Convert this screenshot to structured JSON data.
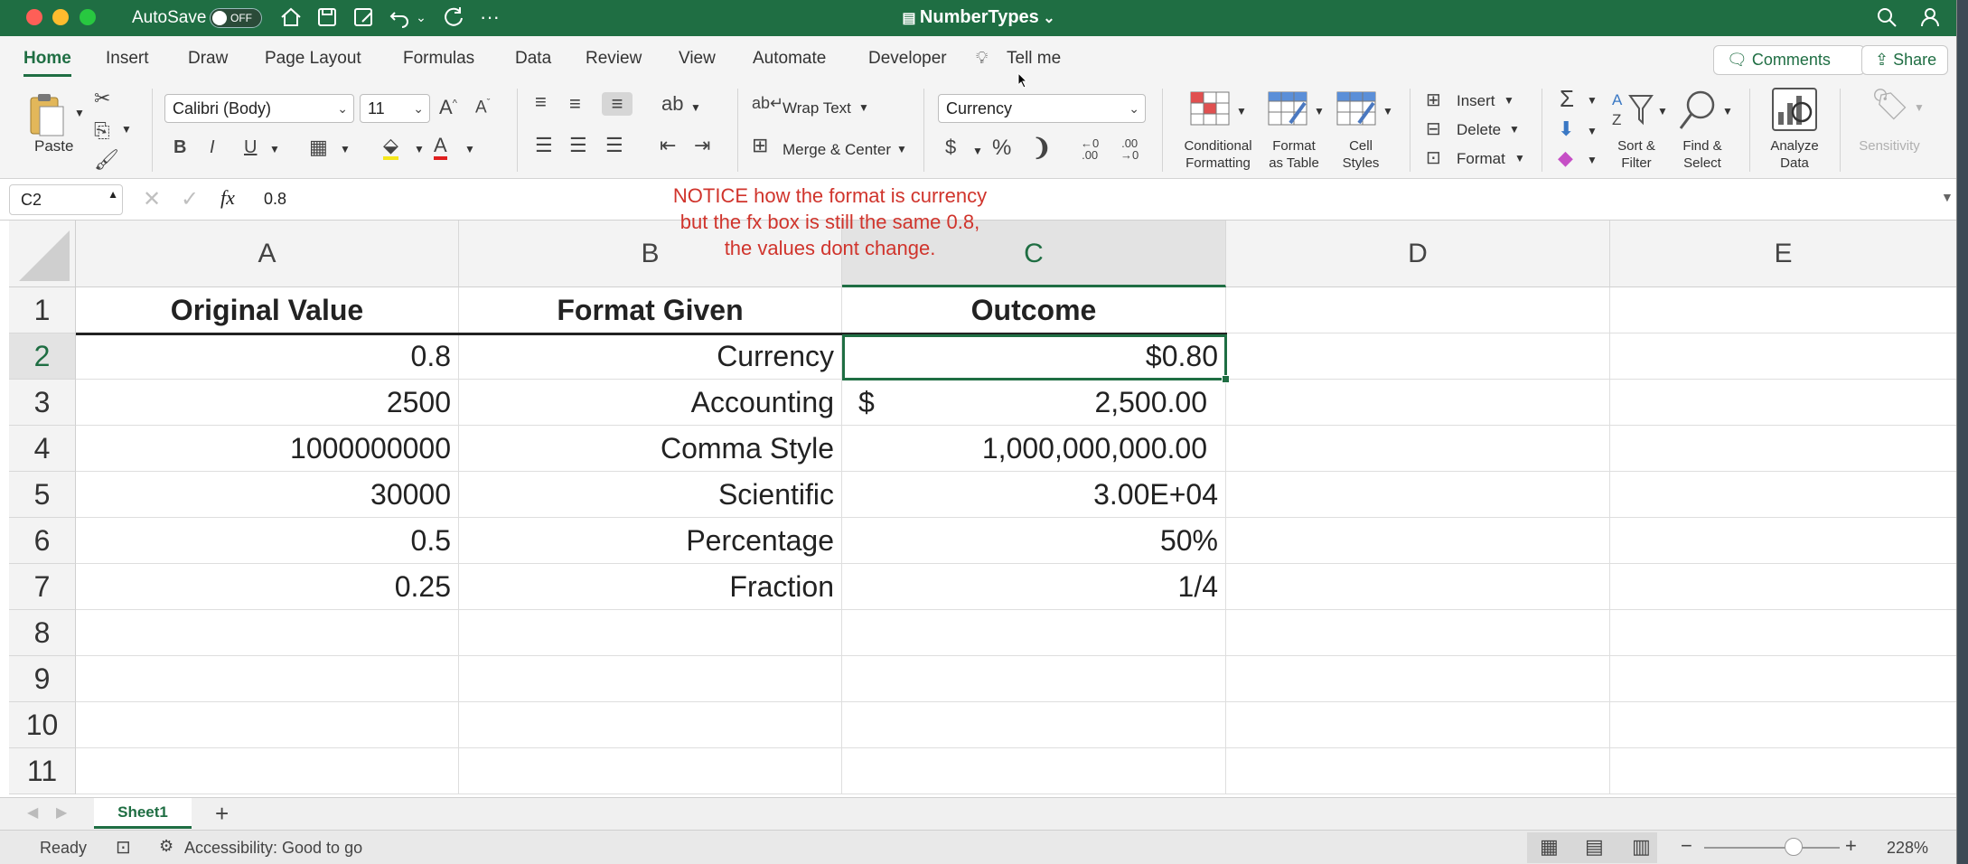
{
  "titlebar": {
    "autosave_label": "AutoSave",
    "autosave_state": "OFF",
    "doc_title": "NumberTypes"
  },
  "tabs": [
    "Home",
    "Insert",
    "Draw",
    "Page Layout",
    "Formulas",
    "Data",
    "Review",
    "View",
    "Automate",
    "Developer"
  ],
  "tell_me": "Tell me",
  "comments_label": "Comments",
  "share_label": "Share",
  "ribbon": {
    "paste": "Paste",
    "font_name": "Calibri (Body)",
    "font_size": "11",
    "wrap_text": "Wrap Text",
    "merge_center": "Merge & Center",
    "number_format": "Currency",
    "conditional": [
      "Conditional",
      "Formatting"
    ],
    "format_table": [
      "Format",
      "as Table"
    ],
    "cell_styles": [
      "Cell",
      "Styles"
    ],
    "insert": "Insert",
    "delete": "Delete",
    "format": "Format",
    "sort_filter": [
      "Sort &",
      "Filter"
    ],
    "find_select": [
      "Find &",
      "Select"
    ],
    "analyze": [
      "Analyze",
      "Data"
    ],
    "sensitivity": "Sensitivity"
  },
  "formula_bar": {
    "name_box": "C2",
    "fx": "fx",
    "value": "0.8"
  },
  "notice_lines": [
    "NOTICE how the format is currency",
    "but the fx box is still the same 0.8,",
    "the values dont change."
  ],
  "columns": [
    "A",
    "B",
    "C",
    "D",
    "E"
  ],
  "rows": [
    "1",
    "2",
    "3",
    "4",
    "5",
    "6",
    "7",
    "8",
    "9",
    "10",
    "11"
  ],
  "headers": {
    "a": "Original Value",
    "b": "Format Given",
    "c": "Outcome"
  },
  "table": [
    {
      "a": "0.8",
      "b": "Currency",
      "c": "$0.80"
    },
    {
      "a": "2500",
      "b": "Accounting",
      "c_sym": "$",
      "c": "2,500.00"
    },
    {
      "a": "1000000000",
      "b": "Comma Style",
      "c": "1,000,000,000.00"
    },
    {
      "a": "30000",
      "b": "Scientific",
      "c": "3.00E+04"
    },
    {
      "a": "0.5",
      "b": "Percentage",
      "c": "50%"
    },
    {
      "a": "0.25",
      "b": "Fraction",
      "c": "1/4"
    }
  ],
  "sheet_tab": "Sheet1",
  "status": {
    "ready": "Ready",
    "accessibility": "Accessibility: Good to go",
    "zoom": "228%"
  }
}
